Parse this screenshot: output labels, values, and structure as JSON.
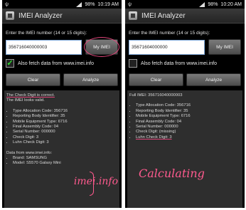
{
  "left": {
    "status": {
      "usb": "ψ",
      "time": "10:19 AM",
      "battery": "98%"
    },
    "title": "IMEI Analyzer",
    "prompt": "Enter the IMEI number (14 or 15 digits):",
    "input_value": "356716040000003",
    "my_imei_label": "My IMEI",
    "fetch_label": "Also fetch data from www.imei.info",
    "fetch_checked": "✓",
    "clear_label": "Clear",
    "analyze_label": "Analyze",
    "line1": "The Check Digit is correct.",
    "line2": "The IMEI looks valid.",
    "details": [
      "Type Allocation Code: 356716",
      "Reporting Body Identifier: 35",
      "Mobile Equipment Type: 6716",
      "Final Assembly Code: 04",
      "Serial Number: 000000",
      "Check Digit: 3",
      "Luhn Check Digit: 3"
    ],
    "fetched_header": "Data from www.imei.info:",
    "fetched": [
      "Brand: SAMSUNG",
      "Model: S5570 Galaxy Mini"
    ],
    "annotation": "imei.info"
  },
  "right": {
    "status": {
      "usb": "ψ",
      "time": "10:20 AM",
      "battery": "98%"
    },
    "title": "IMEI Analyzer",
    "prompt": "Enter the IMEI number (14 or 15 digits):",
    "input_value": "35671604000000",
    "my_imei_label": "My IMEI",
    "fetch_label": "Also fetch data from www.imei.info",
    "fetch_checked": "",
    "clear_label": "Clear",
    "analyze_label": "Analyze",
    "full_imei": "Full IMEI: 356716040000003",
    "details": [
      "Type Allocation Code: 356716",
      "Reporting Body Identifier: 35",
      "Mobile Equipment Type: 6716",
      "Final Assembly Code: 04",
      "Serial Number: 000000",
      "Check Digit: (missing)",
      "Luhn Check Digit: 3"
    ],
    "annotation": "Calculating"
  }
}
